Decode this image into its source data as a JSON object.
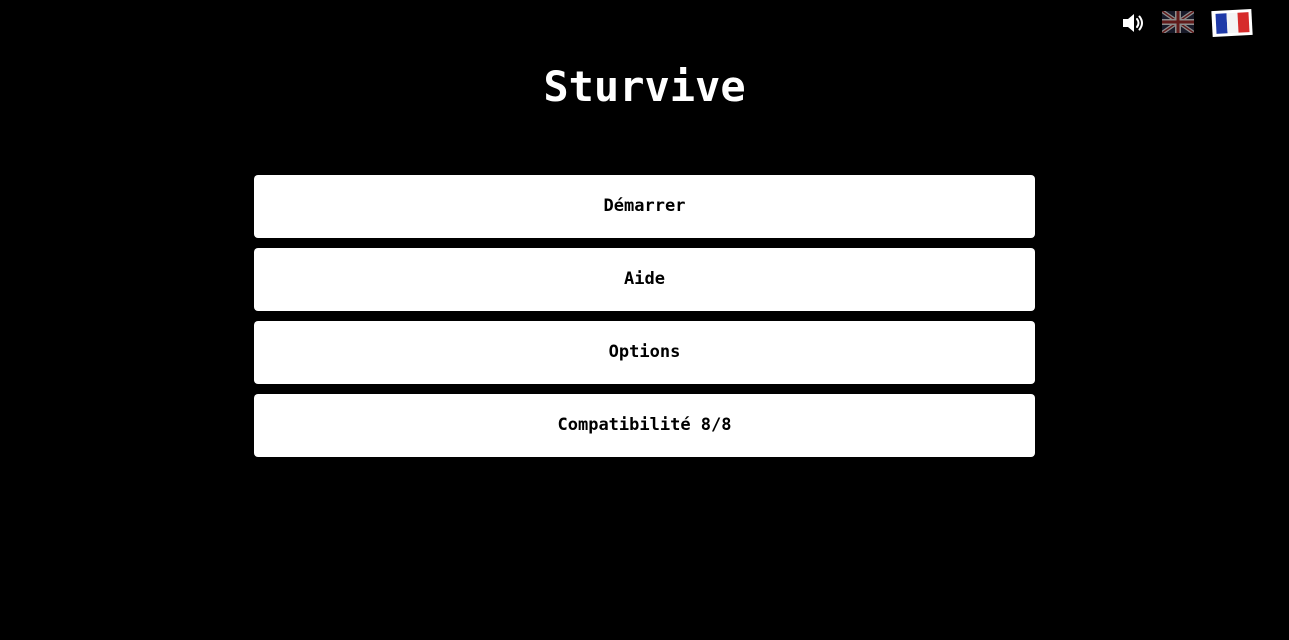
{
  "header": {
    "icons": {
      "sound": "speaker-volume-icon",
      "english": "uk-flag-icon",
      "french": "france-flag-icon"
    }
  },
  "title": "Sturvive",
  "menu": {
    "start_label": "Démarrer",
    "help_label": "Aide",
    "options_label": "Options",
    "compat_label": "Compatibilité 8/8"
  },
  "colors": {
    "background": "#000000",
    "button_bg": "#ffffff",
    "button_text": "#000000",
    "title_text": "#ffffff",
    "fr_blue": "#1f3aa8",
    "fr_red": "#d62b2b"
  }
}
